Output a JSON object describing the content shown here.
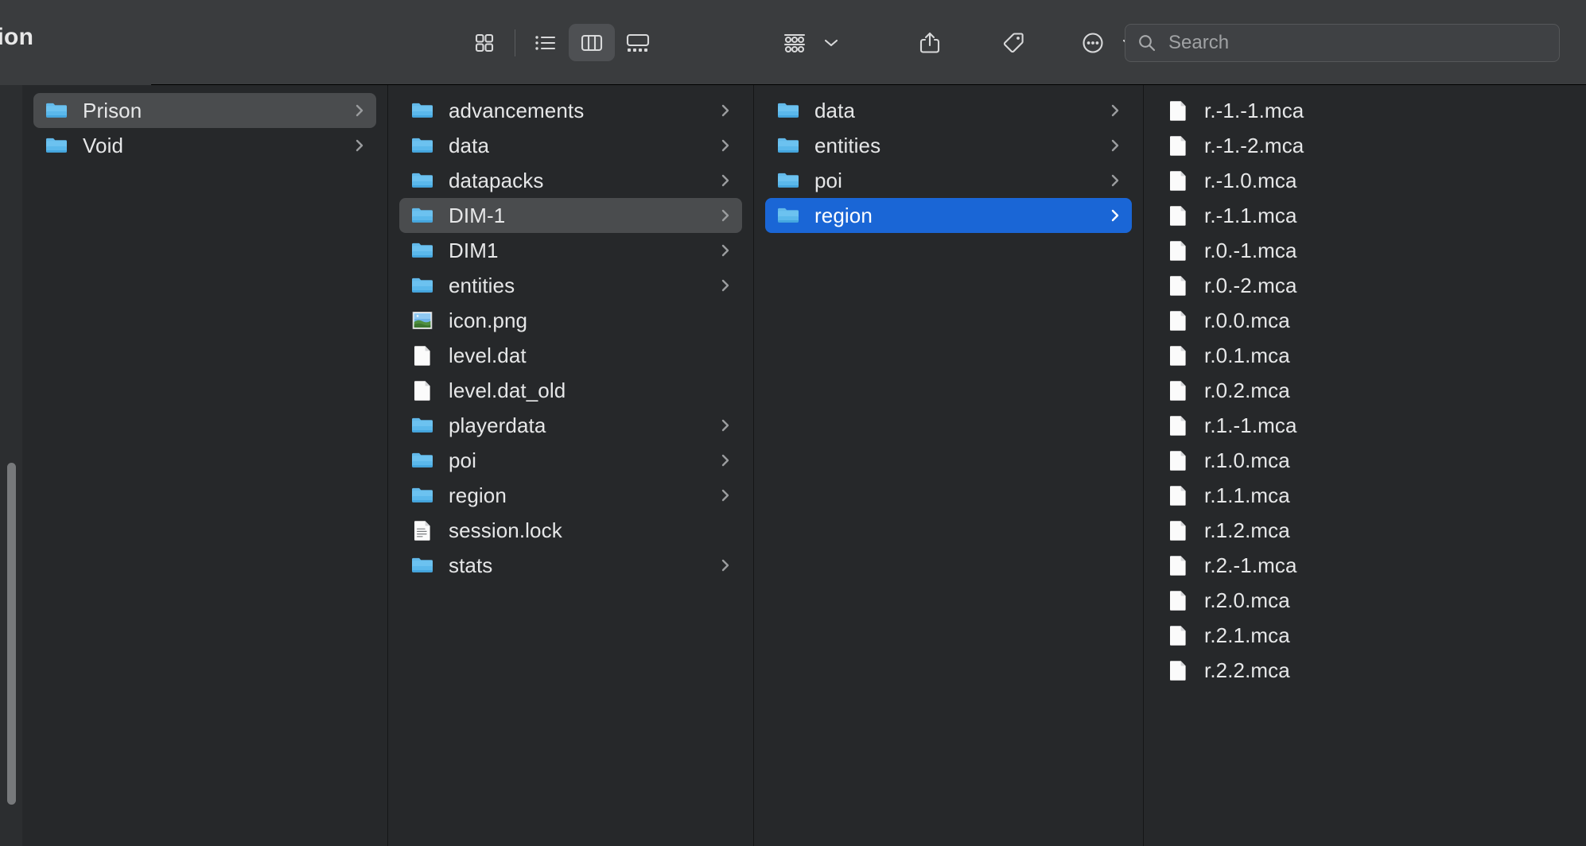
{
  "window": {
    "title": "gion",
    "title_full_hint": "region"
  },
  "toolbar": {
    "view_buttons": [
      {
        "name": "icon-view",
        "label": "Icon View",
        "active": false
      },
      {
        "name": "list-view",
        "label": "List View",
        "active": false
      },
      {
        "name": "column-view",
        "label": "Column View",
        "active": true
      },
      {
        "name": "gallery-view",
        "label": "Gallery View",
        "active": false
      }
    ],
    "group_button_label": "Group",
    "share_button_label": "Share",
    "tag_button_label": "Tags",
    "more_button_label": "More"
  },
  "search": {
    "placeholder": "Search",
    "value": ""
  },
  "columns": [
    {
      "name": "column-1",
      "items": [
        {
          "label": "Prison",
          "kind": "folder",
          "arrow": true,
          "state": "selected-inactive"
        },
        {
          "label": "Void",
          "kind": "folder",
          "arrow": true,
          "state": "normal"
        }
      ]
    },
    {
      "name": "column-2",
      "items": [
        {
          "label": "advancements",
          "kind": "folder",
          "arrow": true,
          "state": "normal"
        },
        {
          "label": "data",
          "kind": "folder",
          "arrow": true,
          "state": "normal"
        },
        {
          "label": "datapacks",
          "kind": "folder",
          "arrow": true,
          "state": "normal"
        },
        {
          "label": "DIM-1",
          "kind": "folder",
          "arrow": true,
          "state": "selected-inactive"
        },
        {
          "label": "DIM1",
          "kind": "folder",
          "arrow": true,
          "state": "normal"
        },
        {
          "label": "entities",
          "kind": "folder",
          "arrow": true,
          "state": "normal"
        },
        {
          "label": "icon.png",
          "kind": "image",
          "arrow": false,
          "state": "normal"
        },
        {
          "label": "level.dat",
          "kind": "document",
          "arrow": false,
          "state": "normal"
        },
        {
          "label": "level.dat_old",
          "kind": "document",
          "arrow": false,
          "state": "normal"
        },
        {
          "label": "playerdata",
          "kind": "folder",
          "arrow": true,
          "state": "normal"
        },
        {
          "label": "poi",
          "kind": "folder",
          "arrow": true,
          "state": "normal"
        },
        {
          "label": "region",
          "kind": "folder",
          "arrow": true,
          "state": "normal"
        },
        {
          "label": "session.lock",
          "kind": "text",
          "arrow": false,
          "state": "normal"
        },
        {
          "label": "stats",
          "kind": "folder",
          "arrow": true,
          "state": "normal"
        }
      ]
    },
    {
      "name": "column-3",
      "items": [
        {
          "label": "data",
          "kind": "folder",
          "arrow": true,
          "state": "normal"
        },
        {
          "label": "entities",
          "kind": "folder",
          "arrow": true,
          "state": "normal"
        },
        {
          "label": "poi",
          "kind": "folder",
          "arrow": true,
          "state": "normal"
        },
        {
          "label": "region",
          "kind": "folder",
          "arrow": true,
          "state": "selected-active"
        }
      ]
    },
    {
      "name": "column-4",
      "items": [
        {
          "label": "r.-1.-1.mca",
          "kind": "document",
          "arrow": false,
          "state": "normal"
        },
        {
          "label": "r.-1.-2.mca",
          "kind": "document",
          "arrow": false,
          "state": "normal"
        },
        {
          "label": "r.-1.0.mca",
          "kind": "document",
          "arrow": false,
          "state": "normal"
        },
        {
          "label": "r.-1.1.mca",
          "kind": "document",
          "arrow": false,
          "state": "normal"
        },
        {
          "label": "r.0.-1.mca",
          "kind": "document",
          "arrow": false,
          "state": "normal"
        },
        {
          "label": "r.0.-2.mca",
          "kind": "document",
          "arrow": false,
          "state": "normal"
        },
        {
          "label": "r.0.0.mca",
          "kind": "document",
          "arrow": false,
          "state": "normal"
        },
        {
          "label": "r.0.1.mca",
          "kind": "document",
          "arrow": false,
          "state": "normal"
        },
        {
          "label": "r.0.2.mca",
          "kind": "document",
          "arrow": false,
          "state": "normal"
        },
        {
          "label": "r.1.-1.mca",
          "kind": "document",
          "arrow": false,
          "state": "normal"
        },
        {
          "label": "r.1.0.mca",
          "kind": "document",
          "arrow": false,
          "state": "normal"
        },
        {
          "label": "r.1.1.mca",
          "kind": "document",
          "arrow": false,
          "state": "normal"
        },
        {
          "label": "r.1.2.mca",
          "kind": "document",
          "arrow": false,
          "state": "normal"
        },
        {
          "label": "r.2.-1.mca",
          "kind": "document",
          "arrow": false,
          "state": "normal"
        },
        {
          "label": "r.2.0.mca",
          "kind": "document",
          "arrow": false,
          "state": "normal"
        },
        {
          "label": "r.2.1.mca",
          "kind": "document",
          "arrow": false,
          "state": "normal"
        },
        {
          "label": "r.2.2.mca",
          "kind": "document",
          "arrow": false,
          "state": "normal"
        }
      ]
    }
  ],
  "colors": {
    "toolbar_bg": "#3a3c3e",
    "column_bg": "#26282a",
    "selection_active": "#1a66d6",
    "selection_inactive": "#4a4c4e",
    "folder_blue": "#5fb8ee",
    "text": "#e6e7e8"
  }
}
